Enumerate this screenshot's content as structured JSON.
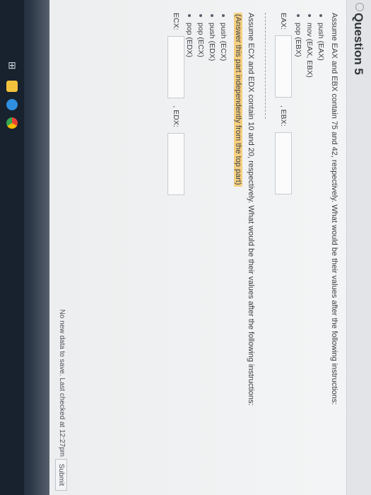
{
  "question": {
    "title": "Question 5",
    "part1": {
      "prompt": "Assume EAX and EBX contain 75 and 42, respectively. What would be their values after the following instructions:",
      "instructions": [
        "push (EAX)",
        "mov (EAX, EBX)",
        "pop (EBX)"
      ],
      "field_labels": [
        "EAX:",
        ", EBX:"
      ]
    },
    "part2": {
      "prompt": "Assume ECX and EDX contain 10 and 20, respectively. What would be their values after the following instructions:",
      "note": "(Answer this part independently from the top part)",
      "instructions": [
        "push (ECX)",
        "push (EDX)",
        "pop (ECX)",
        "pop (EDX)"
      ],
      "field_labels": [
        "ECX:",
        ", EDX:"
      ]
    }
  },
  "status": {
    "text": "No new data to save. Last checked at 12:27pm",
    "submit_label": "Submit"
  },
  "colors": {
    "highlight": "#f6cf7f",
    "background": "#eef0f2",
    "taskbar": "#18222e"
  },
  "taskbar_icons": [
    "grid-icon",
    "file-explorer-icon",
    "edge-icon",
    "chrome-icon"
  ]
}
